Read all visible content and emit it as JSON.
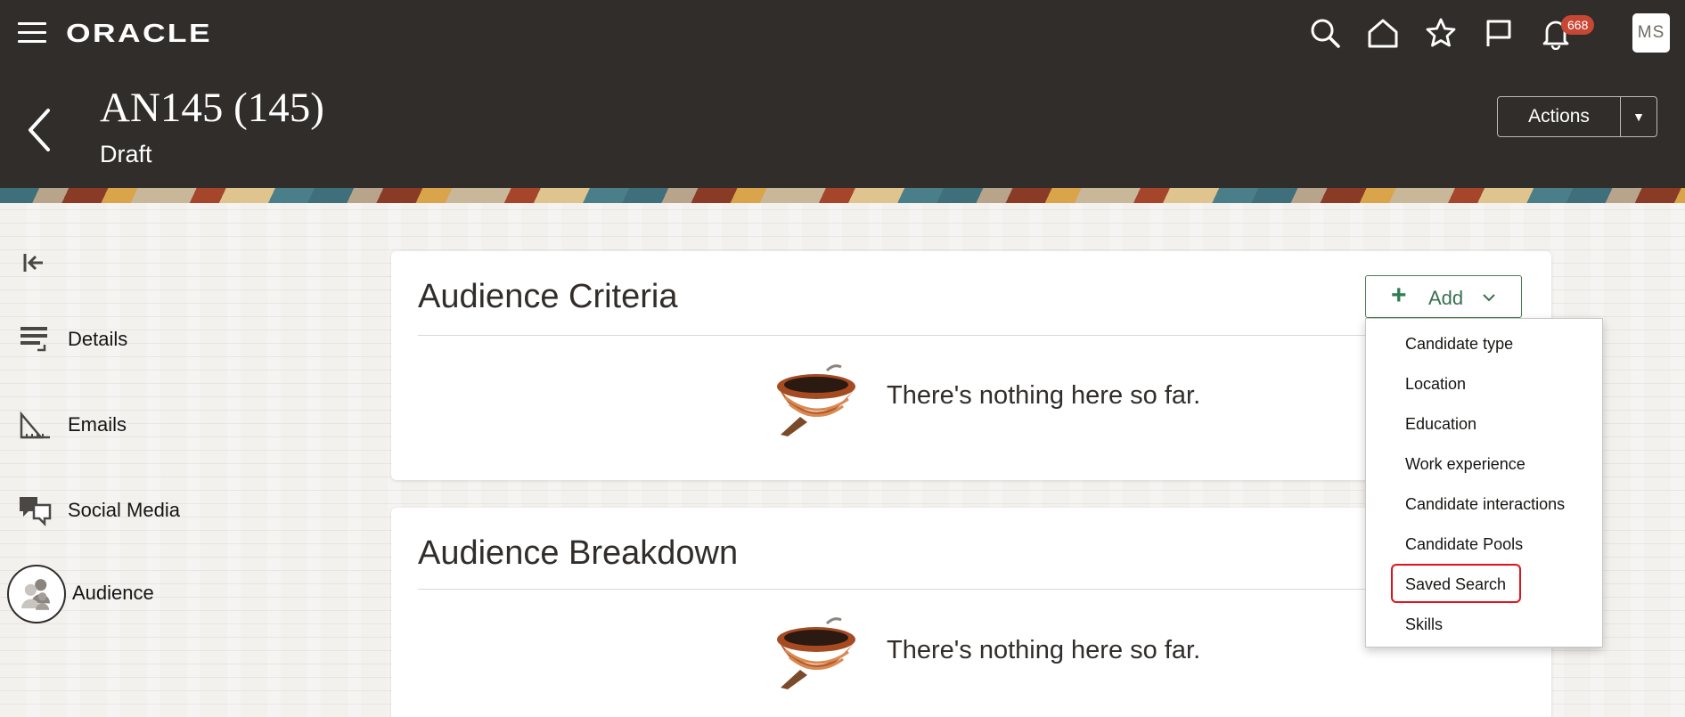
{
  "topbar": {
    "logo": "ORACLE",
    "notification_count": "668",
    "avatar_initials": "MS"
  },
  "header": {
    "title": "AN145 (145)",
    "status": "Draft",
    "actions_label": "Actions"
  },
  "sidenav": {
    "items": [
      {
        "label": "Details",
        "icon": "details-icon"
      },
      {
        "label": "Emails",
        "icon": "emails-icon"
      },
      {
        "label": "Social Media",
        "icon": "social-media-icon"
      },
      {
        "label": "Audience",
        "icon": "audience-icon",
        "active": true
      }
    ]
  },
  "cards": {
    "criteria": {
      "title": "Audience Criteria",
      "empty_text": "There's nothing here so far."
    },
    "breakdown": {
      "title": "Audience Breakdown",
      "empty_text": "There's nothing here so far."
    }
  },
  "add_button": {
    "label": "Add"
  },
  "add_menu": {
    "items": [
      "Candidate type",
      "Location",
      "Education",
      "Work experience",
      "Candidate interactions",
      "Candidate Pools",
      "Saved Search",
      "Skills"
    ],
    "highlighted": "Saved Search"
  },
  "colors": {
    "header_bg": "#312d2a",
    "badge": "#c74634",
    "add_accent": "#2e7d4f",
    "highlight": "#e0121a"
  }
}
